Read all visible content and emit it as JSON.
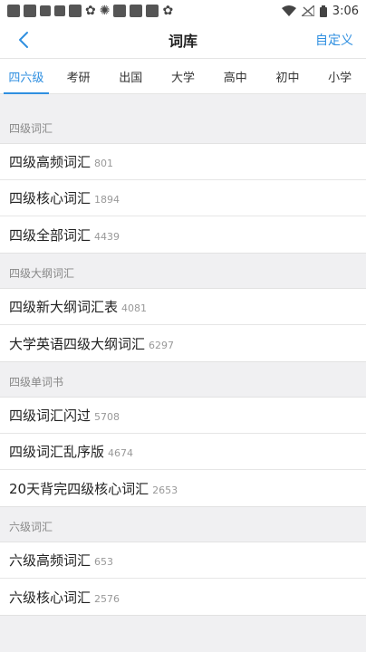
{
  "status_bar": {
    "time": "3:06"
  },
  "header": {
    "title": "词库",
    "action_label": "自定义"
  },
  "tabs": [
    {
      "label": "四六级",
      "active": true
    },
    {
      "label": "考研",
      "active": false
    },
    {
      "label": "出国",
      "active": false
    },
    {
      "label": "大学",
      "active": false
    },
    {
      "label": "高中",
      "active": false
    },
    {
      "label": "初中",
      "active": false
    },
    {
      "label": "小学",
      "active": false
    }
  ],
  "sections": [
    {
      "title": "四级词汇",
      "items": [
        {
          "title": "四级高频词汇",
          "count": "801"
        },
        {
          "title": "四级核心词汇",
          "count": "1894"
        },
        {
          "title": "四级全部词汇",
          "count": "4439"
        }
      ]
    },
    {
      "title": "四级大纲词汇",
      "items": [
        {
          "title": "四级新大纲词汇表",
          "count": "4081"
        },
        {
          "title": "大学英语四级大纲词汇",
          "count": "6297"
        }
      ]
    },
    {
      "title": "四级单词书",
      "items": [
        {
          "title": "四级词汇闪过",
          "count": "5708"
        },
        {
          "title": "四级词汇乱序版",
          "count": "4674"
        },
        {
          "title": "20天背完四级核心词汇",
          "count": "2653"
        }
      ]
    },
    {
      "title": "六级词汇",
      "items": [
        {
          "title": "六级高频词汇",
          "count": "653"
        },
        {
          "title": "六级核心词汇",
          "count": "2576"
        }
      ]
    }
  ],
  "colors": {
    "accent": "#2f8fe0",
    "background": "#f0f0f2"
  }
}
